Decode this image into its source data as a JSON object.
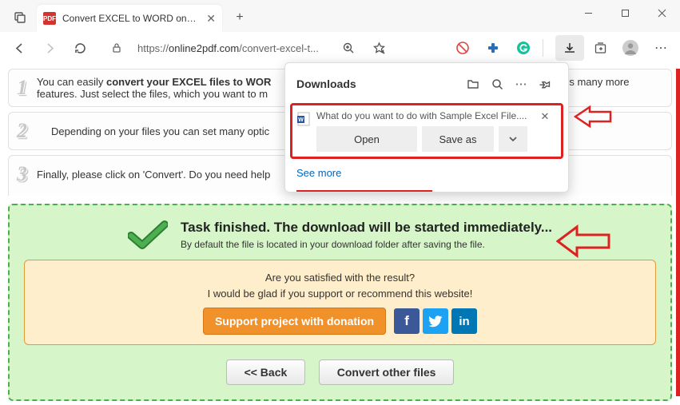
{
  "window": {
    "tab_title": "Convert EXCEL to WORD online &",
    "favicon_text": "PDF"
  },
  "toolbar": {
    "url_proto": "https://",
    "url_host": "online2pdf.com",
    "url_path": "/convert-excel-t..."
  },
  "steps": {
    "s1_num": "1",
    "s1_a": "You can easily ",
    "s1_b": "convert your EXCEL files to WOR",
    "s1_c": "  offers many more",
    "s1_d": "features. Just select the files, which you want to m",
    "s2_num": "2",
    "s2_text": "Depending on your files you can set many optic",
    "s3_num": "3",
    "s3_text": "Finally, please click on 'Convert'. Do you need help"
  },
  "downloads": {
    "title": "Downloads",
    "question": "What do you want to do with Sample Excel File....",
    "open": "Open",
    "saveas": "Save as",
    "seemore": "See more"
  },
  "finished": {
    "heading": "Task finished. The download will be started immediately...",
    "sub": "By default the file is located in your download folder after saving the file."
  },
  "peach": {
    "l1": "Are you satisfied with the result?",
    "l2": "I would be glad if you support or recommend this website!",
    "support": "Support project with donation",
    "fb": "f",
    "tw": "t",
    "li": "in"
  },
  "buttons": {
    "back": "<< Back",
    "convert": "Convert other files"
  }
}
